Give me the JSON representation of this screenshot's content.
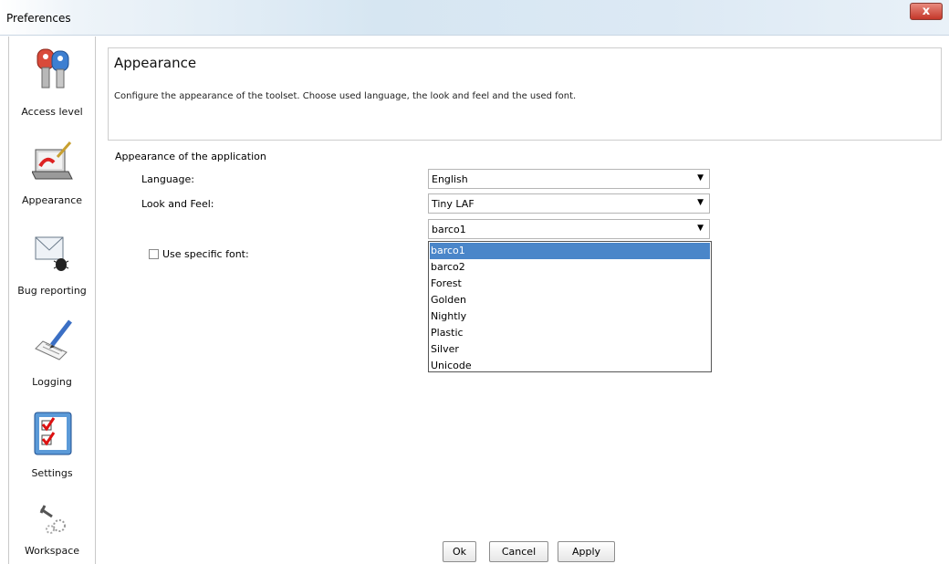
{
  "window": {
    "title": "Preferences",
    "close_symbol": "x"
  },
  "sidebar": {
    "items": [
      {
        "label": "Access level",
        "icon": "keys-icon"
      },
      {
        "label": "Appearance",
        "icon": "laptop-paint-icon"
      },
      {
        "label": "Bug reporting",
        "icon": "envelope-bug-icon"
      },
      {
        "label": "Logging",
        "icon": "pencil-document-icon"
      },
      {
        "label": "Settings",
        "icon": "checklist-icon"
      },
      {
        "label": "Workspace",
        "icon": "tools-gear-icon"
      }
    ]
  },
  "header": {
    "title": "Appearance",
    "description": "Configure the appearance of the toolset. Choose used language, the look and feel and the used font."
  },
  "form": {
    "section_label": "Appearance of the application",
    "language": {
      "label": "Language:",
      "value": "English"
    },
    "look_and_feel": {
      "label": "Look and Feel:",
      "value": "Tiny LAF"
    },
    "theme": {
      "value": "barco1",
      "options": [
        "barco1",
        "barco2",
        "Forest",
        "Golden",
        "Nightly",
        "Plastic",
        "Silver",
        "Unicode"
      ],
      "selected_index": 0
    },
    "use_font": {
      "label": "Use specific font:",
      "checked": false
    }
  },
  "footer": {
    "ok": "Ok",
    "cancel": "Cancel",
    "apply": "Apply"
  }
}
